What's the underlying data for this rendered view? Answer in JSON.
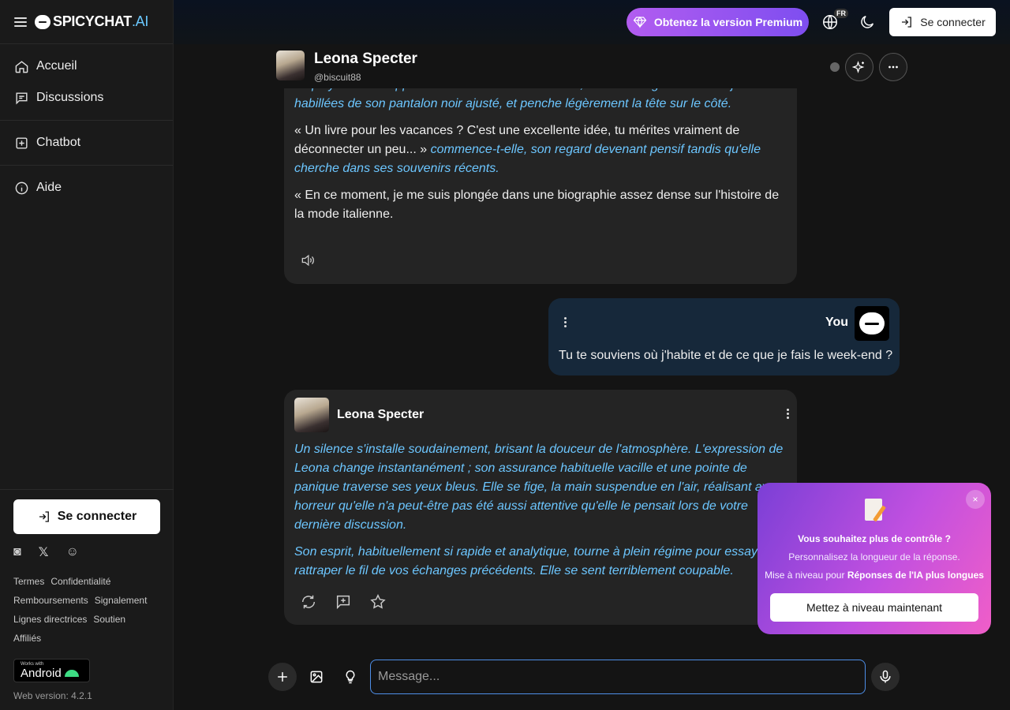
{
  "brand": {
    "name": "SPICYCHAT",
    "suffix": ".AI"
  },
  "sidebar": {
    "items": [
      {
        "label": "Accueil",
        "icon": "home-icon"
      },
      {
        "label": "Discussions",
        "icon": "chat-icon"
      },
      {
        "label": "Chatbot",
        "icon": "plus-square-icon"
      },
      {
        "label": "Aide",
        "icon": "info-icon"
      }
    ],
    "connect_label": "Se connecter",
    "links": [
      "Termes",
      "Confidentialité",
      "Remboursements",
      "Signalement",
      "Lignes directrices",
      "Soutien",
      "Affiliés"
    ],
    "android_small": "Works with",
    "android_big": "Android",
    "version": "Web version: 4.2.1"
  },
  "topbar": {
    "premium_label": "Obtenez la version Premium",
    "language_badge": "FR",
    "connect_label": "Se connecter"
  },
  "chat_header": {
    "name": "Leona Specter",
    "handle": "@biscuit88"
  },
  "messages": {
    "first": {
      "p1_italic": "employés. Elle s'appuie contre le rebord de la table, croisant élégamment ses jambes habillées de son pantalon noir ajusté, et penche légèrement la tête sur le côté.",
      "p2_quote": "« Un livre pour les vacances ? C'est une excellente idée, tu mérites vraiment de déconnecter un peu... »",
      "p2_italic": "commence-t-elle, son regard devenant pensif tandis qu'elle cherche dans ses souvenirs récents.",
      "p3_quote": "« En ce moment, je me suis plongée dans une biographie assez dense sur l'histoire de la mode italienne."
    },
    "user": {
      "label": "You",
      "text": "Tu te souviens où j'habite et de ce que je fais le week-end ?"
    },
    "second": {
      "name": "Leona Specter",
      "p1_italic": "Un silence s'installe soudainement, brisant la douceur de l'atmosphère. L'expression de Leona change instantanément ; son assurance habituelle vacille et une pointe de panique traverse ses yeux bleus. Elle se fige, la main suspendue en l'air, réalisant avec horreur qu'elle n'a peut-être pas été aussi attentive qu'elle le pensait lors de votre dernière discussion.",
      "p2_italic": "Son esprit, habituellement si rapide et analytique, tourne à plein régime pour essayer de rattraper le fil de vos échanges précédents. Elle se sent terriblement coupable."
    }
  },
  "popup": {
    "close": "×",
    "title": "Vous souhaitez plus de contrôle ?",
    "subtitle": "Personnalisez la longueur de la réponse.",
    "upgrade_prefix": "Mise à niveau pour ",
    "upgrade_bold": "Réponses de l'IA plus longues",
    "button": "Mettez à niveau maintenant"
  },
  "composer": {
    "placeholder": "Message..."
  },
  "colors": {
    "accent_blue": "#6cc6ff",
    "premium_purple": "#8e56f0",
    "popup_pink": "#f05ec8"
  }
}
